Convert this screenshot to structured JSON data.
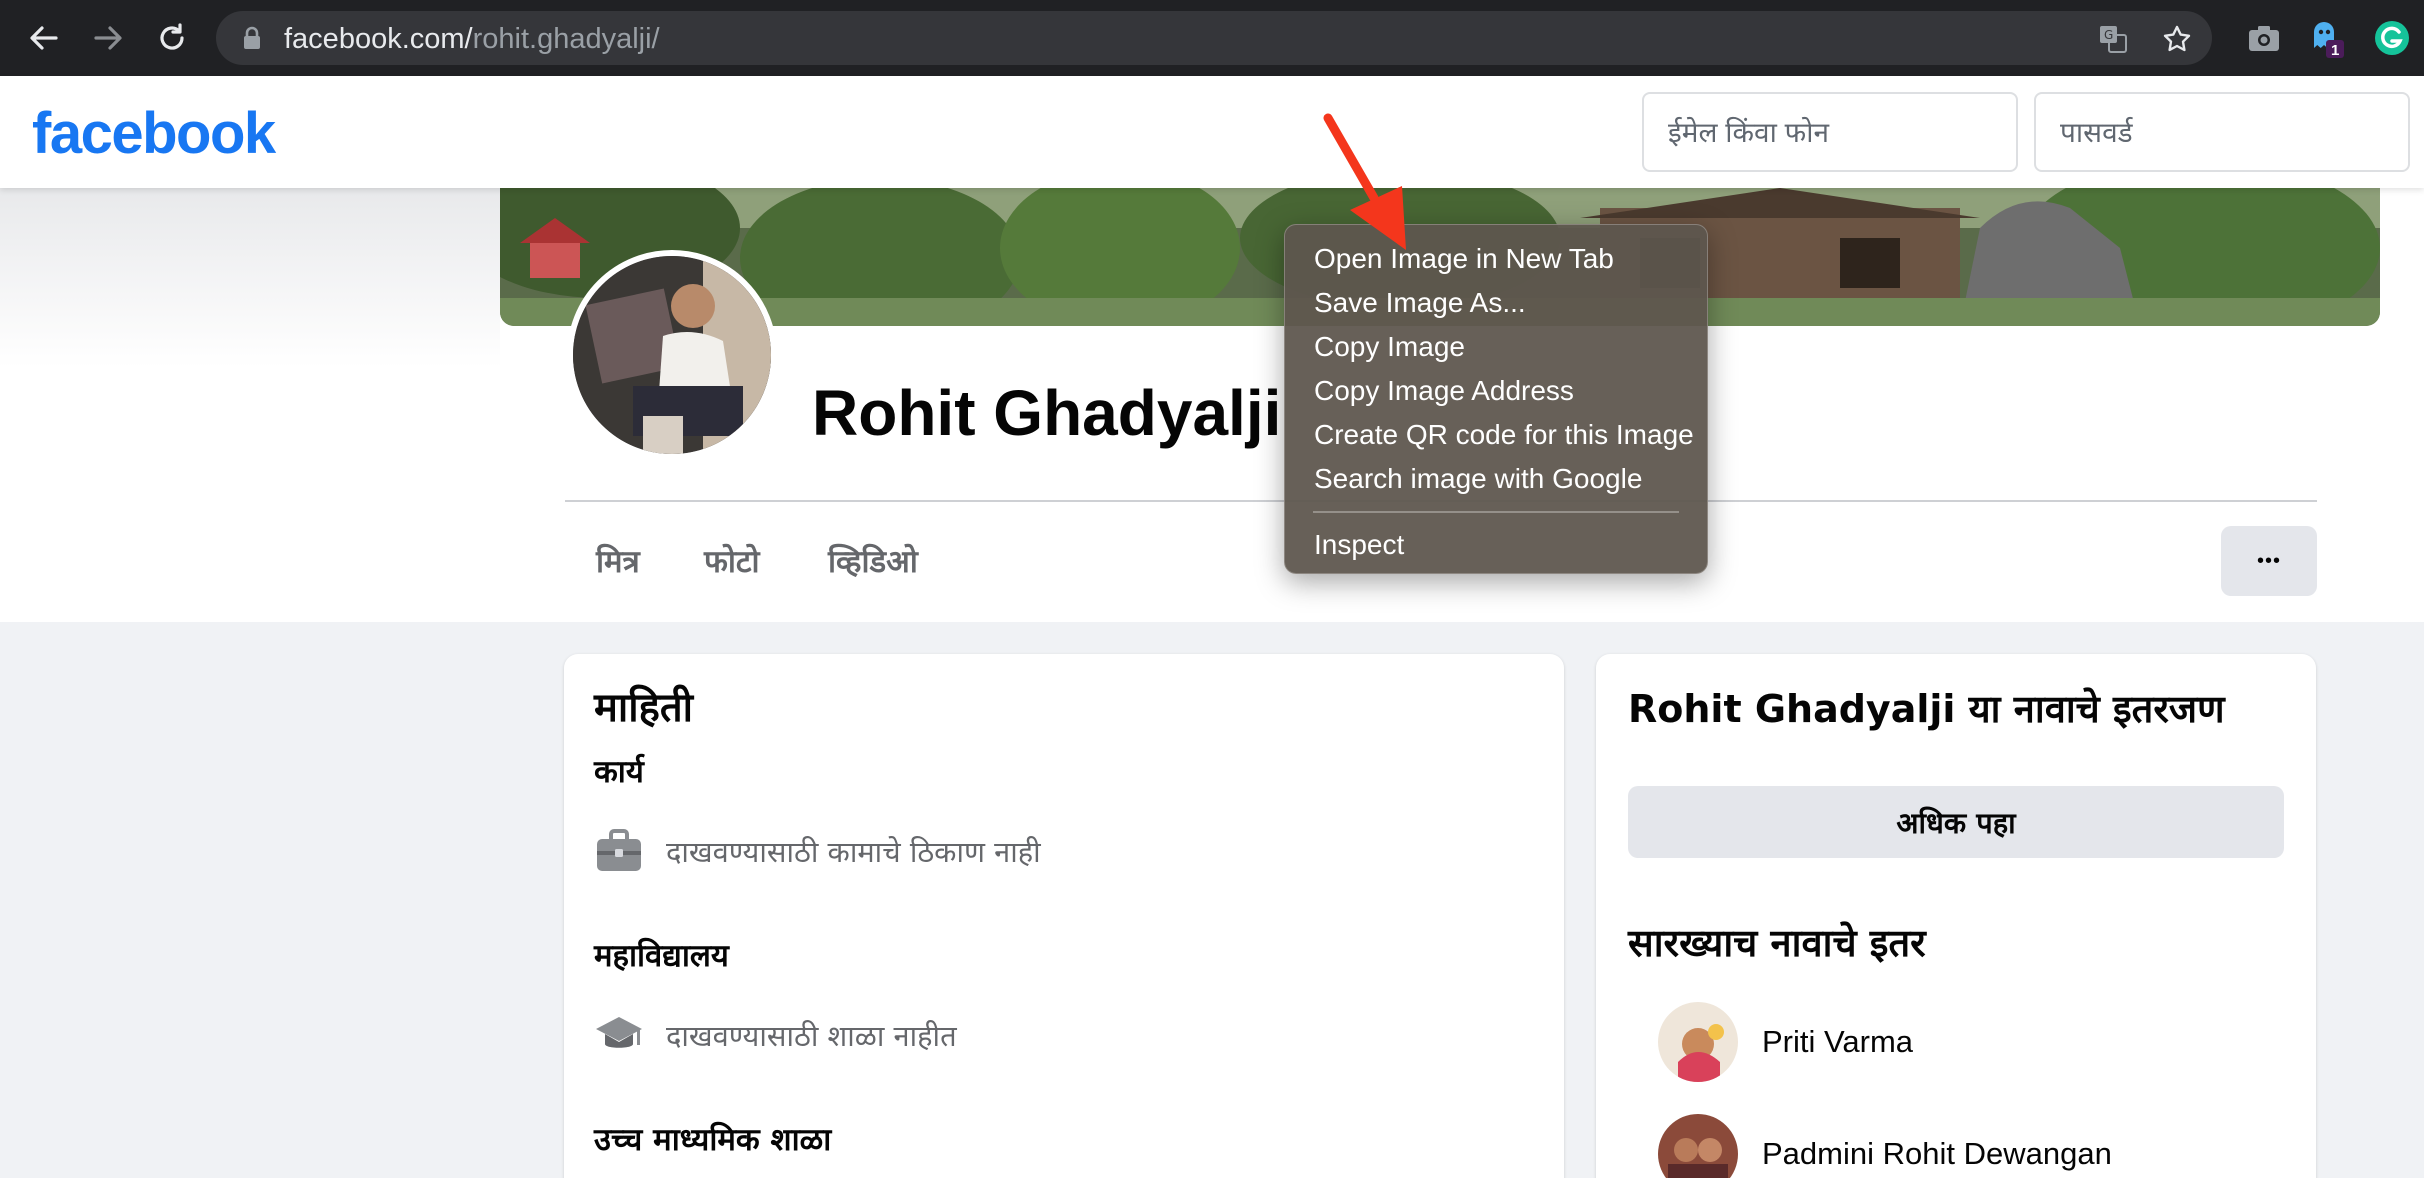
{
  "browser": {
    "url_host": "facebook.com/",
    "url_path": "rohit.ghadyalji/",
    "extension_badge": "1"
  },
  "header": {
    "logo": "facebook",
    "email_placeholder": "ईमेल किंवा फोन",
    "password_placeholder": "पासवर्ड"
  },
  "profile": {
    "name": "Rohit Ghadyalji",
    "tabs": [
      "मित्र",
      "फोटो",
      "व्हिडिओ"
    ],
    "more_label": "•••"
  },
  "about": {
    "title": "माहिती",
    "work_heading": "कार्य",
    "work_text": "दाखवण्यासाठी कामाचे ठिकाण नाही",
    "college_heading": "महाविद्यालय",
    "college_text": "दाखवण्यासाठी शाळा नाहीत",
    "highschool_heading": "उच्च माध्यमिक शाळा"
  },
  "others": {
    "title": "Rohit Ghadyalji या नावाचे इतरजण",
    "see_more": "अधिक पहा",
    "similar_title": "सारख्याच नावाचे इतर",
    "people": [
      "Priti Varma",
      "Padmini Rohit Dewangan"
    ]
  },
  "context_menu": {
    "items": [
      "Open Image in New Tab",
      "Save Image As...",
      "Copy Image",
      "Copy Image Address",
      "Create QR code for this Image",
      "Search image with Google"
    ],
    "inspect": "Inspect"
  },
  "colors": {
    "brand": "#1877f2",
    "annotation_arrow": "#f4361c"
  }
}
